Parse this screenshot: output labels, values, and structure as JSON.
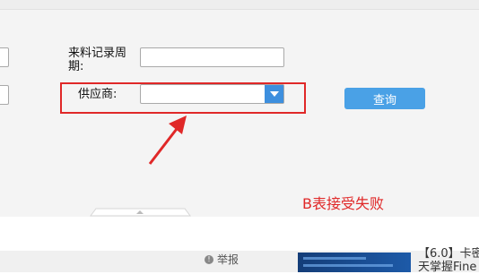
{
  "form": {
    "record_period_label": "来料记录周期:",
    "supplier_label": "供应商:",
    "record_period_value": "",
    "supplier_value": "",
    "query_button_label": "查询"
  },
  "annotation": {
    "text": "B表接受失败",
    "color": "#e02828"
  },
  "footer": {
    "report_label": "举报",
    "side_text_line1": "【6.0】卡密",
    "side_text_line2": "天掌握Fine"
  },
  "colors": {
    "accent": "#4aa1e6",
    "highlight": "#e02828"
  }
}
